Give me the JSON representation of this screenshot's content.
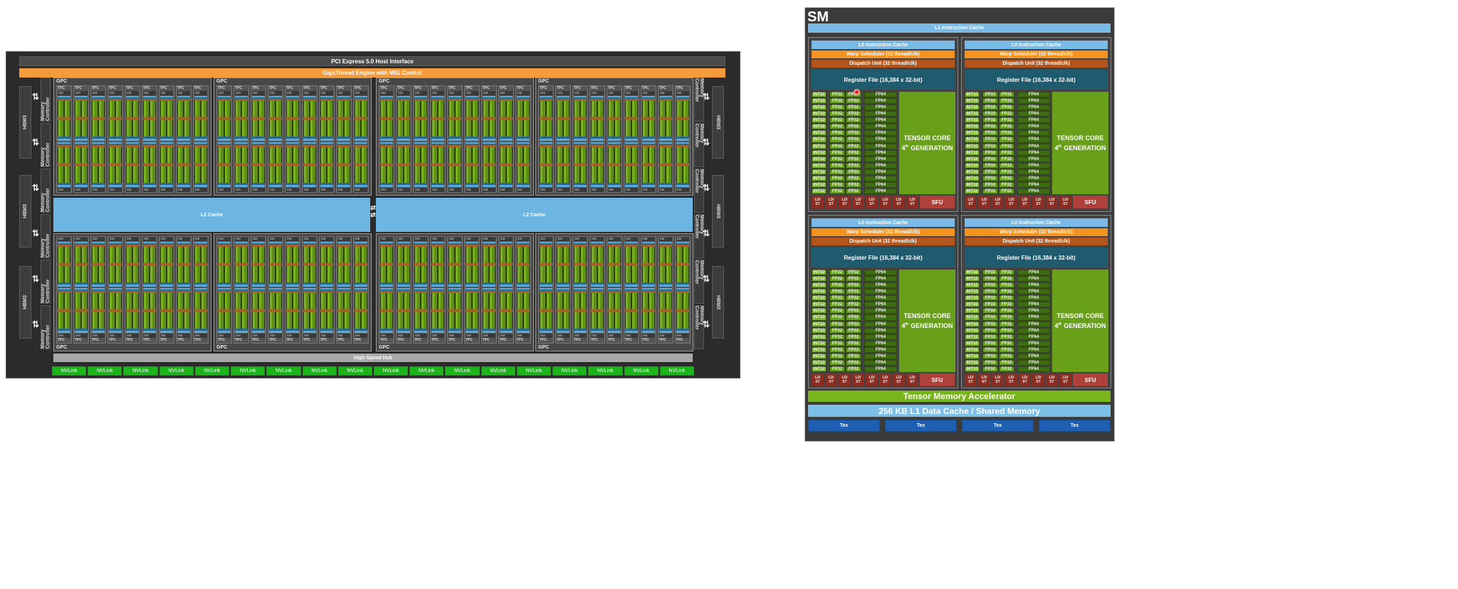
{
  "gpu": {
    "pcie": "PCI Express 5.0 Host Interface",
    "gigathread": "GigaThread Engine with MIG Control",
    "hbm": "HBM3",
    "memory_controller": "Memory Controller",
    "gpc": "GPC",
    "tpc": "TPC",
    "sm": "SM",
    "l2_cache": "L2 Cache",
    "hub": "High-Speed Hub",
    "nvlink": "NVLink",
    "nvlink_count": 18,
    "gpc_count": 8,
    "tpc_per_gpc": 9
  },
  "sm_detail": {
    "title": "SM",
    "l1_instruction_cache": "L1 Instruction Cache",
    "partition": {
      "l0": "L0 Instruction Cache",
      "warp": "Warp Scheduler (32 thread/clk)",
      "dispatch": "Dispatch Unit (32 thread/clk)",
      "register_file": "Register File (16,384 x 32-bit)",
      "int32": "INT32",
      "fp32": "FP32",
      "fp64": "FP64",
      "tensor_line1": "TENSOR CORE",
      "tensor_num": "4",
      "tensor_sup": "th",
      "tensor_line2": "GENERATION",
      "ld": "LD/",
      "st": "ST",
      "sfu": "SFU",
      "rows": 16,
      "ldst_units": 8
    },
    "tma": "Tensor Memory Accelerator",
    "l1_data": "256 KB L1 Data Cache / Shared Memory",
    "tex": "Tex",
    "tex_count": 4
  }
}
